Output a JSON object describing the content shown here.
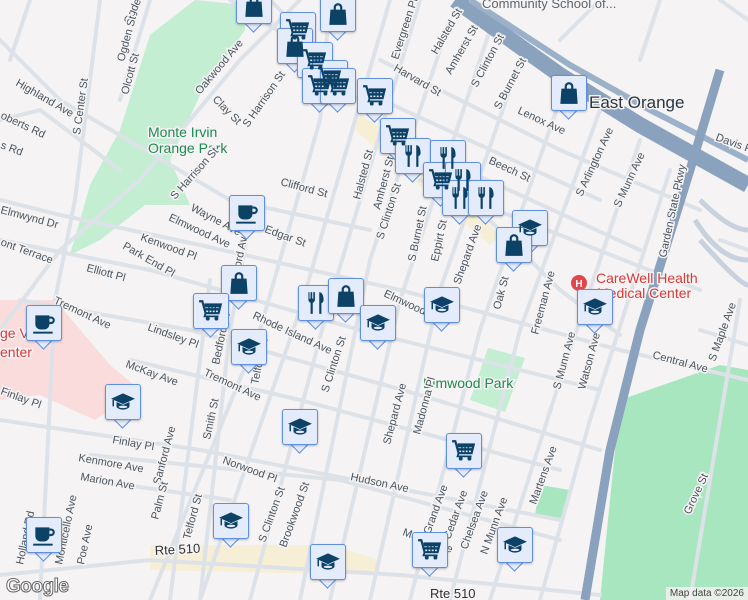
{
  "map": {
    "colors": {
      "background": "#f5f3f3",
      "road": "#dde2e8",
      "highway": "#8aa2bd",
      "park": "#c3eed2",
      "park_dark": "#a8e6bf",
      "hospital_area": "#fbdcdc",
      "commercial": "#f7eed6",
      "marker_bg": "#e4ecfc",
      "marker_border": "#5f8fe0",
      "marker_icon": "#0d4267"
    },
    "labels": [
      "Ogden St",
      "Olcott St",
      "Highland Ave",
      "oberts Rd",
      "s Rd",
      "S Center St",
      "Monte Irvin",
      "Orange Park",
      "Oakwood Ave",
      "Clay St",
      "S Harrison St",
      "S Harrison St",
      "Clifford St",
      "Wayne Ave",
      "Edgar St",
      "Elmwood Ave",
      "Kenwood Pl",
      "Park End Pl",
      "Elliott Pl",
      "Elmwynd Dr",
      "ont Terrace",
      "Halsted St",
      "Amherst St",
      "S Clinton St",
      "S Burnet St",
      "Eppirt St",
      "Shepard Ave",
      "Oak St",
      "Freeman Ave",
      "S Munn Ave",
      "Watson Ave",
      "Central Ave",
      "S Maple Ave",
      "Elmwood Park",
      "Shepard Ave",
      "Madonna Pl",
      "Martens Ave",
      "Grove St",
      "Hudson Ave",
      "Grand Ave",
      "Cedar Ave",
      "Chelsea Ave",
      "N Munn Ave",
      "Rte 510",
      "Rte 510",
      "Harvard St",
      "Halsted St",
      "Amherst St",
      "S Clinton St",
      "S Burnet St",
      "Lenox Ave",
      "Beech St",
      "S Arlington Ave",
      "S Munn Ave",
      "Garden State Pkwy",
      "Davis Pl",
      "East Orange",
      "Community School of...",
      "CareWell Health",
      "Medical Center",
      "Evergreen Pl",
      "Rhode Island Ave",
      "Lindsley Pl",
      "Tremont Ave",
      "Tremont Ave",
      "McKay Ave",
      "Finlay Pl",
      "Finlay Pl",
      "Kenmore Ave",
      "Marion Ave",
      "Sanford Ave",
      "Sanford Ave",
      "Smith St",
      "Bedford St",
      "Telford St",
      "Norwood Pl",
      "S Clinton St",
      "S Clinton St",
      "Brookwood St",
      "Palm St",
      "Telford St",
      "Elmwood Ave",
      "Monticello Ave",
      "Poe Ave",
      "Holland Rd",
      "ge VA",
      "enter",
      "Ogden St",
      "Moore Ave",
      "Central Ave"
    ],
    "markers": [
      {
        "type": "shopping-bag"
      },
      {
        "type": "shopping-bag"
      },
      {
        "type": "cart"
      },
      {
        "type": "shopping-bag"
      },
      {
        "type": "cart"
      },
      {
        "type": "cart"
      },
      {
        "type": "cart"
      },
      {
        "type": "cart"
      },
      {
        "type": "cart"
      },
      {
        "type": "cart"
      },
      {
        "type": "restaurant"
      },
      {
        "type": "restaurant"
      },
      {
        "type": "cart"
      },
      {
        "type": "restaurant"
      },
      {
        "type": "restaurant"
      },
      {
        "type": "restaurant"
      },
      {
        "type": "school"
      },
      {
        "type": "shopping-bag"
      },
      {
        "type": "coffee"
      },
      {
        "type": "shopping-bag"
      },
      {
        "type": "cart"
      },
      {
        "type": "restaurant"
      },
      {
        "type": "shopping-bag"
      },
      {
        "type": "school"
      },
      {
        "type": "school"
      },
      {
        "type": "school"
      },
      {
        "type": "coffee"
      },
      {
        "type": "school"
      },
      {
        "type": "school"
      },
      {
        "type": "school"
      },
      {
        "type": "cart"
      },
      {
        "type": "school"
      },
      {
        "type": "coffee"
      },
      {
        "type": "cart"
      },
      {
        "type": "school"
      },
      {
        "type": "school"
      },
      {
        "type": "shopping-bag"
      }
    ],
    "logo": "Google",
    "attribution": "Map data ©2026"
  }
}
